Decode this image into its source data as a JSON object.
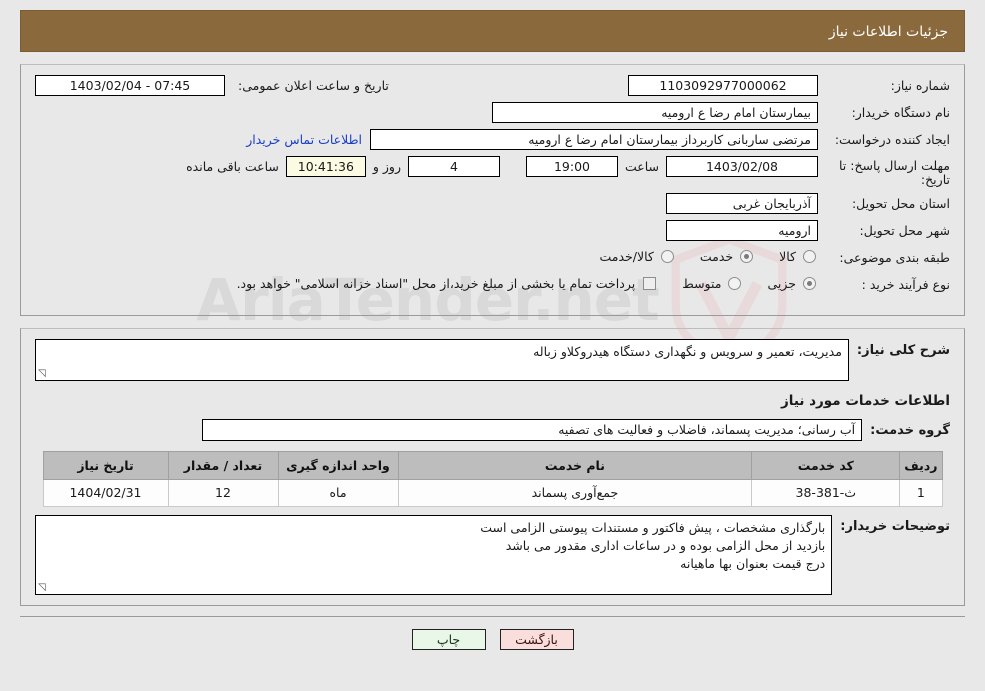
{
  "header": {
    "title": "جزئیات اطلاعات نیاز"
  },
  "watermark": {
    "text": "AriaTender.net"
  },
  "form": {
    "need_number_label": "شماره نیاز:",
    "need_number_value": "1103092977000062",
    "announce_label": "تاریخ و ساعت اعلان عمومی:",
    "announce_value": "1403/02/04 - 07:45",
    "buyer_org_label": "نام دستگاه خریدار:",
    "buyer_org_value": "بیمارستان امام رضا  ع  ارومیه",
    "creator_label": "ایجاد کننده درخواست:",
    "creator_value": "مرتضی ساربانی کاربرداز بیمارستان امام رضا  ع  ارومیه",
    "contact_link": "اطلاعات تماس خریدار",
    "deadline_label": "مهلت ارسال پاسخ: تا تاریخ:",
    "deadline_date": "1403/02/08",
    "hour_label": "ساعت",
    "deadline_time": "19:00",
    "days_value": "4",
    "days_label": "روز و",
    "timer_value": "10:41:36",
    "remaining_label": "ساعت باقی مانده",
    "province_label": "استان محل تحویل:",
    "province_value": "آذربایجان غربی",
    "city_label": "شهر محل تحویل:",
    "city_value": "ارومیه",
    "category_label": "طبقه بندی موضوعی:",
    "category_options": [
      {
        "label": "کالا",
        "selected": false
      },
      {
        "label": "خدمت",
        "selected": true
      },
      {
        "label": "کالا/خدمت",
        "selected": false
      }
    ],
    "process_label": "نوع فرآیند خرید :",
    "process_options": [
      {
        "label": "جزیی",
        "selected": true
      },
      {
        "label": "متوسط",
        "selected": false
      }
    ],
    "treasury_checkbox_checked": false,
    "treasury_note": "پرداخت تمام یا بخشی از مبلغ خرید،از محل \"اسناد خزانه اسلامی\" خواهد بود."
  },
  "description": {
    "label": "شرح کلی نیاز:",
    "value": "مدیریت، تعمیر و سرویس و نگهداری دستگاه هیدروکلاو زباله"
  },
  "services": {
    "heading": "اطلاعات خدمات مورد نیاز",
    "group_label": "گروه خدمت:",
    "group_value": "آب رسانی؛ مدیریت پسماند، فاضلاب و فعالیت های تصفیه"
  },
  "table": {
    "columns": [
      "ردیف",
      "کد خدمت",
      "نام خدمت",
      "واحد اندازه گیری",
      "تعداد / مقدار",
      "تاریخ نیاز"
    ],
    "rows": [
      {
        "radif": "1",
        "code": "ث-381-38",
        "name": "جمع‌آوری پسماند",
        "unit": "ماه",
        "qty": "12",
        "date": "1404/02/31"
      }
    ]
  },
  "buyer_notes": {
    "label": "توضیحات خریدار:",
    "lines": [
      "بارگذاری مشخصات ، پیش فاکتور و مستندات پیوستی الزامی است",
      "بازدید از محل الزامی بوده و در ساعات اداری مقدور می باشد",
      "درج قیمت بعنوان بها ماهیانه"
    ]
  },
  "footer": {
    "print_label": "چاپ",
    "back_label": "بازگشت"
  },
  "colors": {
    "header_bg": "#8a6a3d",
    "link": "#1a3fc4",
    "timer_bg": "#fbfbe4",
    "print_bg": "#e9f7e9",
    "back_bg": "#fadedb",
    "table_header_bg": "#bdbdbd"
  }
}
